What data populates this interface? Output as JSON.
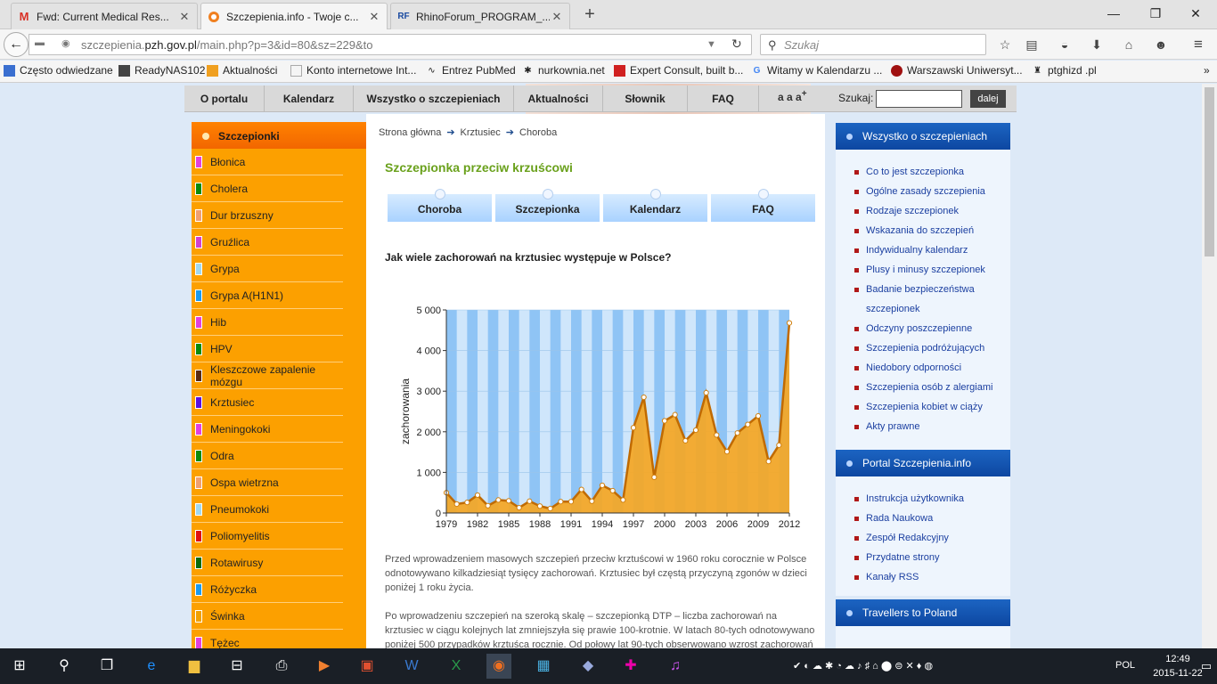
{
  "browser": {
    "tabs": [
      {
        "label": "Fwd: Current Medical Res...",
        "icon": "gmail-icon"
      },
      {
        "label": "Szczepienia.info - Twoje c...",
        "icon": "site-icon"
      },
      {
        "label": "RhinoForum_PROGRAM_...",
        "icon": "rf-icon"
      }
    ],
    "url_prefix": "szczepienia.",
    "url_domain": "pzh.gov.pl",
    "url_rest": "/main.php?p=3&id=80&sz=229&to",
    "search_placeholder": "Szukaj",
    "bookmarks": [
      "Często odwiedzane",
      "ReadyNAS102",
      "Aktualności",
      "Konto internetowe Int...",
      "Entrez PubMed",
      "nurkownia.net",
      "Expert Consult, built b...",
      "Witamy w Kalendarzu ...",
      "Warszawski Uniwersyt...",
      "ptghizd .pl"
    ]
  },
  "site": {
    "topmenu": [
      "O portalu",
      "Kalendarz",
      "Wszystko o szczepieniach",
      "Aktualności",
      "Słownik",
      "FAQ"
    ],
    "fontsize_label": "a a a",
    "fontsize_sup": "+",
    "search_label": "Szukaj:",
    "search_button": "dalej",
    "leftnav_title": "Szczepionki",
    "leftnav": [
      {
        "label": "Błonica",
        "color": "#e040e0"
      },
      {
        "label": "Cholera",
        "color": "#0a8a0a"
      },
      {
        "label": "Dur brzuszny",
        "color": "#f0a070"
      },
      {
        "label": "Gruźlica",
        "color": "#d040d0"
      },
      {
        "label": "Grypa",
        "color": "#a0d8f0"
      },
      {
        "label": "Grypa A(H1N1)",
        "color": "#1a9af0"
      },
      {
        "label": "Hib",
        "color": "#e040e0"
      },
      {
        "label": "HPV",
        "color": "#0a8a0a"
      },
      {
        "label": "Kleszczowe zapalenie mózgu",
        "color": "#5a2a10"
      },
      {
        "label": "Krztusiec",
        "color": "#5a10e0"
      },
      {
        "label": "Meningokoki",
        "color": "#e040e0"
      },
      {
        "label": "Odra",
        "color": "#0a8a0a"
      },
      {
        "label": "Ospa wietrzna",
        "color": "#f0a070"
      },
      {
        "label": "Pneumokoki",
        "color": "#a0d8f0"
      },
      {
        "label": "Poliomyelitis",
        "color": "#e01010"
      },
      {
        "label": "Rotawirusy",
        "color": "#0a6a0a"
      },
      {
        "label": "Różyczka",
        "color": "#1a9af0"
      },
      {
        "label": "Świnka",
        "color": "#f0a000"
      },
      {
        "label": "Tężec",
        "color": "#e040e0"
      }
    ],
    "breadcrumb": [
      "Strona główna",
      "Krztusiec",
      "Choroba"
    ],
    "title": "Szczepionka przeciw krzuścowi",
    "subtabs": [
      "Choroba",
      "Szczepionka",
      "Kalendarz",
      "FAQ"
    ],
    "question": "Jak wiele zachorowań na krztusiec występuje w Polsce?",
    "para1": "Przed wprowadzeniem masowych szczepień przeciw krztuścowi w 1960 roku corocznie w Polsce odnotowywano kilkadziesiąt tysięcy zachorowań. Krztusiec był częstą przyczyną zgonów w dzieci poniżej 1 roku życia.",
    "para2": "Po wprowadzeniu szczepień na szeroką skalę – szczepionką DTP – liczba zachorowań na krztusiec w ciągu kolejnych lat zmniejszyła się prawie 100-krotnie. W latach 80-tych odnotowywano poniżej 500 przypadków krztuśca rocznie. Od połowy lat 90-tych obserwowano wzrost zachorowań na te",
    "right1_title": "Wszystko o szczepieniach",
    "right1": [
      "Co to jest szczepionka",
      "Ogólne zasady szczepienia",
      "Rodzaje szczepionek",
      "Wskazania do szczepień",
      "Indywidualny kalendarz",
      "Plusy i minusy szczepionek",
      "Badanie bezpieczeństwa szczepionek",
      "Odczyny poszczepienne",
      "Szczepienia podróżujących",
      "Niedobory odporności",
      "Szczepienia osób z alergiami",
      "Szczepienia kobiet w ciąży",
      "Akty prawne"
    ],
    "right2_title": "Portal Szczepienia.info",
    "right2": [
      "Instrukcja użytkownika",
      "Rada Naukowa",
      "Zespół Redakcyjny",
      "Przydatne strony",
      "Kanały RSS"
    ],
    "right3_title": "Travellers to Poland"
  },
  "chart_data": {
    "type": "area",
    "title": "",
    "xlabel": "",
    "ylabel": "zachorowania",
    "ylim": [
      0,
      5000
    ],
    "yticks": [
      "0",
      "1 000",
      "2 000",
      "3 000",
      "4 000",
      "5 000"
    ],
    "xticks": [
      "1979",
      "1982",
      "1985",
      "1988",
      "1991",
      "1994",
      "1997",
      "2000",
      "2003",
      "2006",
      "2009",
      "2012"
    ],
    "x": [
      1979,
      1980,
      1981,
      1982,
      1983,
      1984,
      1985,
      1986,
      1987,
      1988,
      1989,
      1990,
      1991,
      1992,
      1993,
      1994,
      1995,
      1996,
      1997,
      1998,
      1999,
      2000,
      2001,
      2002,
      2003,
      2004,
      2005,
      2006,
      2007,
      2008,
      2009,
      2010,
      2011,
      2012
    ],
    "values": [
      500,
      220,
      260,
      440,
      180,
      320,
      300,
      130,
      290,
      170,
      110,
      280,
      280,
      580,
      290,
      680,
      550,
      320,
      2100,
      2850,
      880,
      2270,
      2420,
      1780,
      2040,
      2960,
      1920,
      1510,
      1970,
      2180,
      2390,
      1270,
      1670,
      4680
    ],
    "colors": {
      "fill": "#f5a623",
      "line": "#c06a00",
      "band": "#8fc4f5"
    },
    "grid": true
  },
  "taskbar": {
    "clock_time": "12:49",
    "clock_date": "2015-11-22",
    "lang": "POL"
  }
}
